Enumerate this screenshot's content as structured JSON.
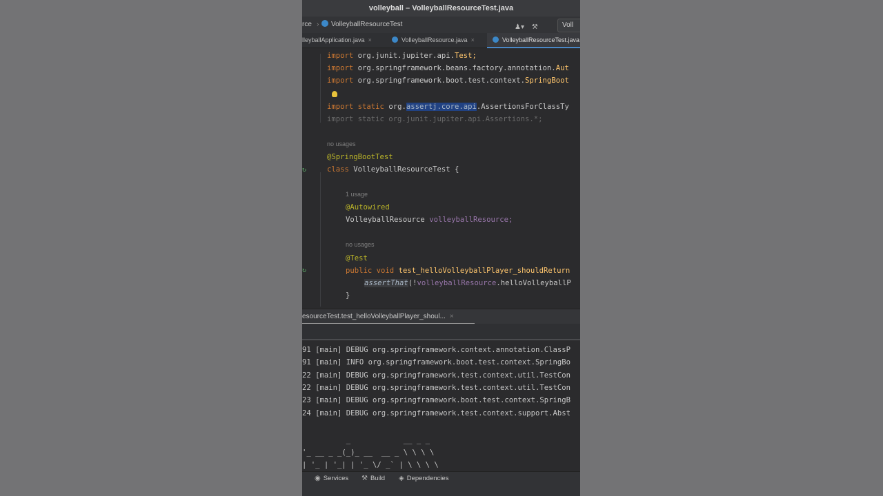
{
  "window": {
    "title": "volleyball – VolleyballResourceTest.java"
  },
  "navbar": {
    "crumb0": "rce",
    "separator": "›",
    "crumb1": "VolleyballResourceTest",
    "tool_user": "♟▾",
    "tool_build": "⚒",
    "run_label": "Voll"
  },
  "tabs": [
    {
      "label": "lleyballApplication.java",
      "close": "×"
    },
    {
      "label": "VolleyballResource.java",
      "close": "×"
    },
    {
      "label": "VolleyballResourceTest.java",
      "close": ""
    }
  ],
  "editor": {
    "imports": [
      {
        "kw": "import",
        "pkg": "org.junit.jupiter.api.",
        "cls": "Test;"
      },
      {
        "kw": "import",
        "pkg": "org.springframework.beans.factory.annotation.",
        "cls": "Aut"
      },
      {
        "kw": "import",
        "pkg": "org.springframework.boot.test.context.",
        "cls": "SpringBoot"
      }
    ],
    "static_import": {
      "kw": "import static",
      "pre": "org.",
      "hl": "assertj.core.api",
      "post": ".AssertionsForClassTy"
    },
    "unused_import": "import static org.junit.jupiter.api.Assertions.*;",
    "hint1": "no usages",
    "class_annotation": "@SpringBootTest",
    "class_kw": "class",
    "class_name": "VolleyballResourceTest {",
    "hint2": "1 usage",
    "field_annotation": "@Autowired",
    "field_type": "VolleyballResource",
    "field_name": "volleyballResource;",
    "hint3": "no usages",
    "method_annotation": "@Test",
    "method_kw": "public void",
    "method_name": "test_helloVolleyballPlayer_shouldReturn",
    "assert_call": "assertThat",
    "assert_open": "(!",
    "assert_field": "volleyballResource",
    "assert_rest": ".helloVolleyballP",
    "close_brace": "}"
  },
  "run_panel": {
    "tab_label": "esourceTest.test_helloVolleyballPlayer_shoul...",
    "close": "×"
  },
  "console": {
    "lines": [
      "91 [main] DEBUG org.springframework.context.annotation.ClassP",
      "91 [main] INFO org.springframework.boot.test.context.SpringBo",
      "22 [main] DEBUG org.springframework.test.context.util.TestCon",
      "22 [main] DEBUG org.springframework.test.context.util.TestCon",
      "23 [main] DEBUG org.springframework.boot.test.context.SpringB",
      "24 [main] DEBUG org.springframework.test.context.support.Abst"
    ],
    "banner": [
      "          _            __ _ _",
      "'_ __ _ _(_)_ __  __ _ \\ \\ \\ \\",
      "| '_ | '_| | '_ \\/ _` | \\ \\ \\ \\"
    ]
  },
  "bottombar": {
    "services": "Services",
    "build": "Build",
    "dependencies": "Dependencies"
  }
}
